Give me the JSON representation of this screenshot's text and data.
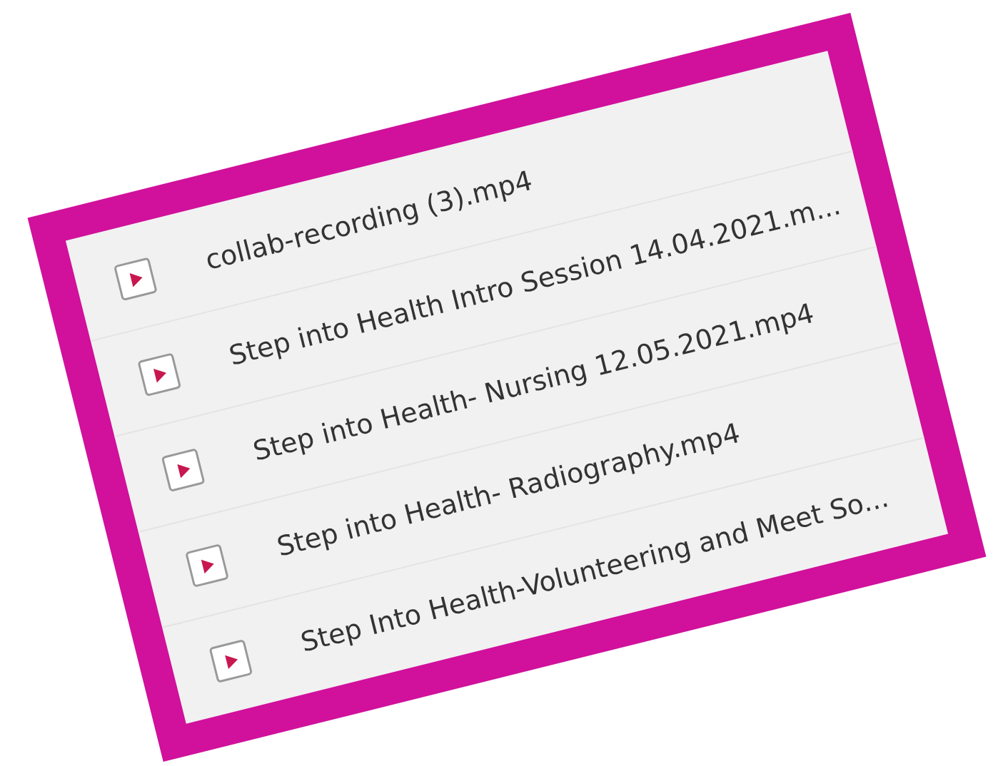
{
  "files": [
    {
      "name": "collab-recording (3).mp4"
    },
    {
      "name": "Step into Health Intro Session 14.04.2021.m..."
    },
    {
      "name": "Step into Health- Nursing 12.05.2021.mp4"
    },
    {
      "name": "Step into Health- Radiography.mp4"
    },
    {
      "name": "Step Into Health-Volunteering and Meet So..."
    }
  ]
}
